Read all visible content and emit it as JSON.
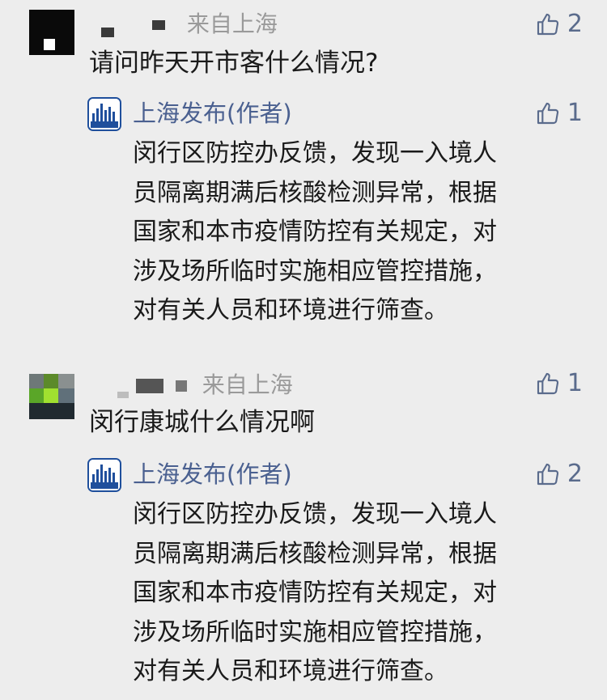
{
  "comments": [
    {
      "user_location": "来自上海",
      "user_location_partial": "来自上海",
      "likes": "2",
      "text": "请问昨天开市客什么情况?",
      "reply": {
        "author": "上海发布(作者)",
        "likes": "1",
        "lines": [
          "闵行区防控办反馈，发现一入境人",
          "员隔离期满后核酸检测异常，根据",
          "国家和本市疫情防控有关规定，对",
          "涉及场所临时实施相应管控措施，",
          "对有关人员和环境进行筛查。"
        ]
      }
    },
    {
      "user_location": "来自上海",
      "likes": "1",
      "text": "闵行康城什么情况啊",
      "reply": {
        "author": "上海发布(作者)",
        "likes": "2",
        "lines": [
          "闵行区防控办反馈，发现一入境人",
          "员隔离期满后核酸检测异常，根据",
          "国家和本市疫情防控有关规定，对",
          "涉及场所临时实施相应管控措施，",
          "对有关人员和环境进行筛查。"
        ]
      }
    }
  ],
  "colors": {
    "background": "#ededed",
    "author_link": "#4a6090",
    "meta_gray": "#9a9a9a",
    "like_icon": "#5a6b8c",
    "official_blue": "#1f4f9c"
  },
  "icons": {
    "like": "thumbs-up-icon",
    "official_avatar": "shanghai-fabu-logo"
  }
}
